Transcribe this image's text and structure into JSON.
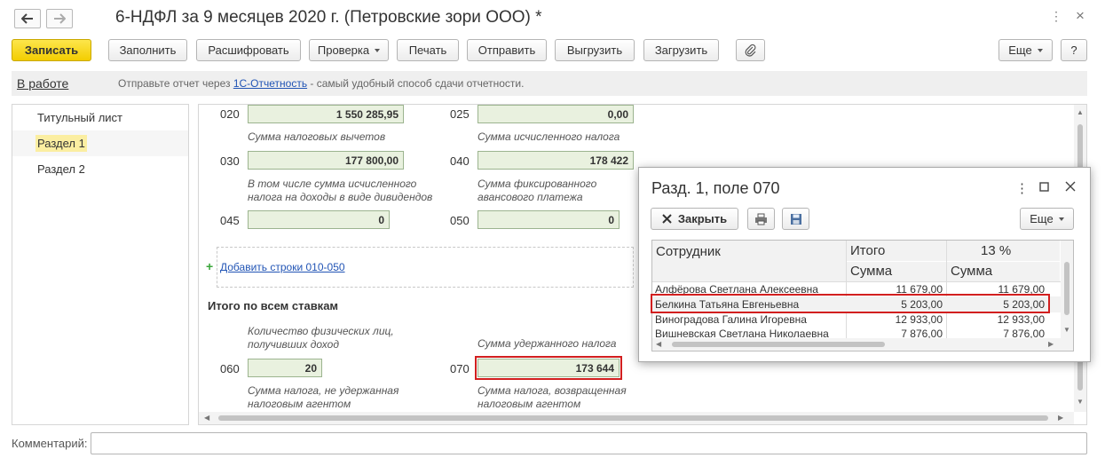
{
  "window": {
    "title": "6-НДФЛ за 9 месяцев 2020 г. (Петровские зори ООО) *",
    "back_icon": "arrow-left",
    "forward_icon": "arrow-right",
    "more_icon": "⋮",
    "close_icon": "×"
  },
  "toolbar": {
    "save": "Записать",
    "fill": "Заполнить",
    "decode": "Расшифровать",
    "check": "Проверка",
    "print": "Печать",
    "send": "Отправить",
    "export": "Выгрузить",
    "import": "Загрузить",
    "more": "Еще",
    "help": "?"
  },
  "infobar": {
    "status": "В работе",
    "text_before": "Отправьте отчет через ",
    "link": "1С-Отчетность",
    "text_after": " - самый удобный способ сдачи отчетности."
  },
  "sidebar": {
    "items": [
      {
        "label": "Титульный лист"
      },
      {
        "label": "Раздел 1"
      },
      {
        "label": "Раздел 2"
      }
    ]
  },
  "form": {
    "f020": {
      "code": "020",
      "value": "1 550 285,95",
      "hint": "Сумма налоговых вычетов"
    },
    "f025": {
      "code": "025",
      "value": "0,00",
      "hint": "Сумма исчисленного налога"
    },
    "f030": {
      "code": "030",
      "value": "177 800,00",
      "hint1": "В том числе сумма исчисленного",
      "hint2": "налога на доходы в виде дивидендов"
    },
    "f040": {
      "code": "040",
      "value": "178 422",
      "hint1": "Сумма фиксированного",
      "hint2": "авансового платежа"
    },
    "f045": {
      "code": "045",
      "value": "0"
    },
    "f050": {
      "code": "050",
      "value": "0"
    },
    "add_rows": "Добавить строки 010-050",
    "total_title": "Итого по всем ставкам",
    "f060": {
      "code": "060",
      "value": "20",
      "top_hint1": "Количество физических лиц,",
      "top_hint2": "получивших доход",
      "hint1": "Сумма налога, не удержанная",
      "hint2": "налоговым агентом"
    },
    "f070": {
      "code": "070",
      "value": "173 644",
      "top_hint": "Сумма удержанного налога",
      "hint1": "Сумма налога, возвращенная",
      "hint2": "налоговым агентом"
    }
  },
  "comment": {
    "label": "Комментарий:",
    "value": ""
  },
  "popup": {
    "title": "Разд. 1, поле 070",
    "close_button": "Закрыть",
    "more": "Еще",
    "columns": {
      "employee": "Сотрудник",
      "total": "Итого",
      "rate": "13 %",
      "sum": "Сумма"
    },
    "rows": [
      {
        "name": "Алфёрова Светлана Алексеевна",
        "total": "11 679,00",
        "rate13": "11 679,00"
      },
      {
        "name": "Белкина Татьяна Евгеньевна",
        "total": "5 203,00",
        "rate13": "5 203,00"
      },
      {
        "name": "Виноградова Галина Игоревна",
        "total": "12 933,00",
        "rate13": "12 933,00"
      },
      {
        "name": "Вишневская Светлана Николаевна",
        "total": "7 876,00",
        "rate13": "7 876,00"
      }
    ]
  },
  "colors": {
    "accent_yellow": "#f3cd00",
    "field_green": "#e9f1df",
    "highlight_red": "#d21f1f",
    "link_blue": "#2154b5"
  }
}
